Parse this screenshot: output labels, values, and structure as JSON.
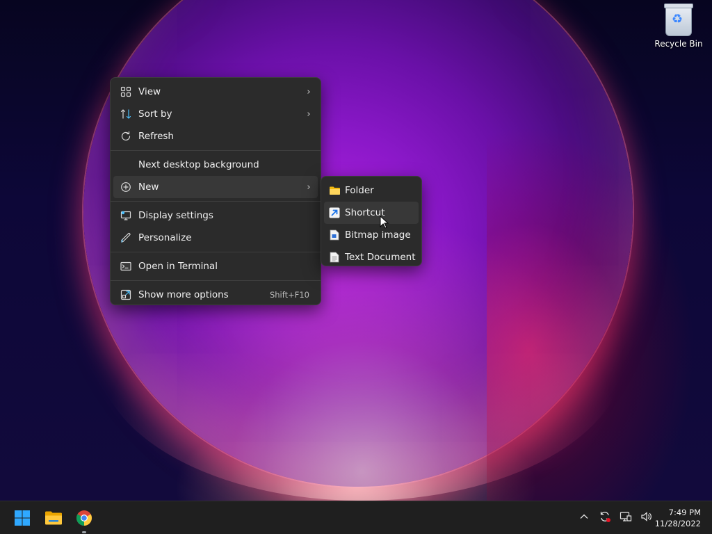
{
  "desktop": {
    "icons": [
      {
        "label": "Recycle Bin",
        "icon": "recycle-bin-icon"
      }
    ]
  },
  "context_menu": {
    "items": [
      {
        "label": "View",
        "icon": "view-grid-icon",
        "has_submenu": true
      },
      {
        "label": "Sort by",
        "icon": "sort-arrows-icon",
        "has_submenu": true
      },
      {
        "label": "Refresh",
        "icon": "refresh-icon",
        "has_submenu": false
      },
      {
        "label": "Next desktop background",
        "icon": "",
        "has_submenu": false
      },
      {
        "label": "New",
        "icon": "plus-circle-icon",
        "has_submenu": true,
        "highlighted": true
      },
      {
        "label": "Display settings",
        "icon": "display-settings-icon",
        "has_submenu": false
      },
      {
        "label": "Personalize",
        "icon": "pen-icon",
        "has_submenu": false
      },
      {
        "label": "Open in Terminal",
        "icon": "terminal-icon",
        "has_submenu": false
      },
      {
        "label": "Show more options",
        "icon": "show-more-icon",
        "accelerator": "Shift+F10"
      }
    ]
  },
  "new_submenu": {
    "items": [
      {
        "label": "Folder",
        "icon": "folder-icon"
      },
      {
        "label": "Shortcut",
        "icon": "shortcut-icon",
        "highlighted": true
      },
      {
        "label": "Bitmap image",
        "icon": "bitmap-file-icon"
      },
      {
        "label": "Text Document",
        "icon": "text-document-icon"
      }
    ]
  },
  "taskbar": {
    "pinned": [
      {
        "name": "start",
        "icon": "windows-start-icon"
      },
      {
        "name": "file-explorer",
        "icon": "folder-icon"
      },
      {
        "name": "chrome",
        "icon": "chrome-icon",
        "running": true
      }
    ],
    "tray": [
      "chevron-up-icon",
      "sync-icon",
      "network-icon",
      "volume-icon"
    ],
    "clock": {
      "time": "7:49 PM",
      "date": "11/28/2022"
    }
  },
  "colors": {
    "menu_bg": "#2b2b2b",
    "menu_hover": "#383838",
    "taskbar_bg": "#1f1f1f",
    "accent": "#4cc2ff"
  }
}
